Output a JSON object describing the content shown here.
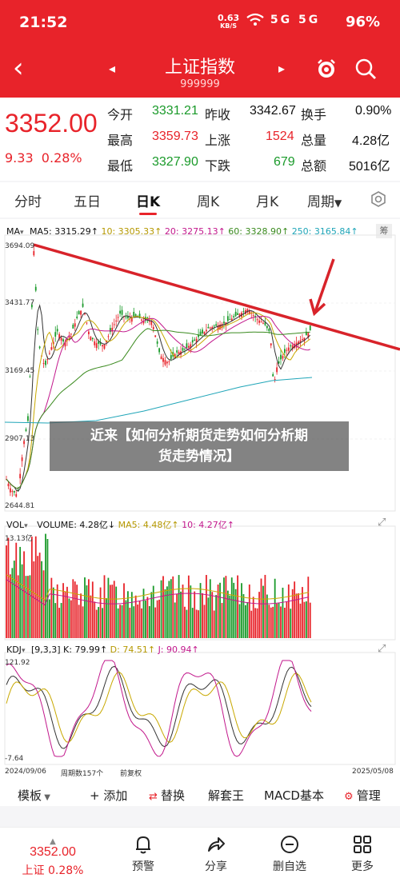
{
  "status": {
    "time": "21:52",
    "net_speed": "0.63",
    "net_unit": "KB/S",
    "signal": "5G 5G",
    "battery": "96%"
  },
  "header": {
    "title": "上证指数",
    "code": "999999",
    "back": "‹",
    "prev": "◂",
    "next": "▸"
  },
  "quote": {
    "price": "3352.00",
    "change": "9.33",
    "change_pct": "0.28%",
    "open_label": "今开",
    "open": "3331.21",
    "prev_close_label": "昨收",
    "prev_close": "3342.67",
    "turnover_label": "换手",
    "turnover": "0.90%",
    "high_label": "最高",
    "high": "3359.73",
    "up_label": "上涨",
    "up": "1524",
    "volume_label": "总量",
    "volume": "4.28亿",
    "low_label": "最低",
    "low": "3327.90",
    "down_label": "下跌",
    "down": "679",
    "amount_label": "总额",
    "amount": "5016亿"
  },
  "tabs": [
    "分时",
    "五日",
    "日K",
    "周K",
    "月K",
    "周期"
  ],
  "active_tab": "日K",
  "ma_legend": {
    "name": "MA",
    "ma5": "MA5: 3315.29↑",
    "ma10": "10: 3305.33↑",
    "ma20": "20: 3275.13↑",
    "ma60": "60: 3328.90↑",
    "ma250": "250: 3165.84↑",
    "side": "筹"
  },
  "colors": {
    "ma5": "#333333",
    "ma10": "#c8a800",
    "ma20": "#c2188c",
    "ma60": "#3a8a1e",
    "ma250": "#1fa5b8",
    "up": "#e8232a",
    "down": "#1a9a2a",
    "trend": "#d8232a"
  },
  "price_axis": [
    "3694.09",
    "3431.77",
    "3169.45",
    "2907.13",
    "2644.81"
  ],
  "vol_legend": {
    "name": "VOL",
    "vol": "VOLUME: 4.28亿↓",
    "ma5": "MA5: 4.48亿↑",
    "ma10": "10: 4.27亿↑",
    "axis_top": "13.13亿"
  },
  "kdj_legend": {
    "name": "KDJ",
    "params": "[9,3,3]",
    "k": "K: 79.99↑",
    "d": "D: 74.51↑",
    "j": "J: 90.94↑",
    "axis_top": "121.92",
    "axis_bottom": "-7.64"
  },
  "date_axis": {
    "start": "2024/09/06",
    "cycle": "周期数157个",
    "adjust": "前复权",
    "end": "2025/05/08"
  },
  "overlay": {
    "line1": "近来【如何分析期货走势如何分析期",
    "line2": "货走势情况】"
  },
  "toolbar": {
    "template": "模板",
    "add": "+ 添加",
    "replace": "替换",
    "tool": "解套王",
    "macd": "MACD基本",
    "manage": "管理"
  },
  "bottom": {
    "price": "3352.00",
    "change_label": "上证 0.28%",
    "alert": "预警",
    "share": "分享",
    "delete": "删自选",
    "more": "更多"
  },
  "chart_data": {
    "type": "candlestick",
    "x_range": [
      "2024/09/06",
      "2025/05/08"
    ],
    "periods": 157,
    "ylim": [
      2644.81,
      3694.09
    ],
    "last_close": 3352.0,
    "trend_line": "descending resistance from 3694.09 peak",
    "volume_top": "13.13亿",
    "kdj_range": [
      -7.64,
      121.92
    ]
  }
}
